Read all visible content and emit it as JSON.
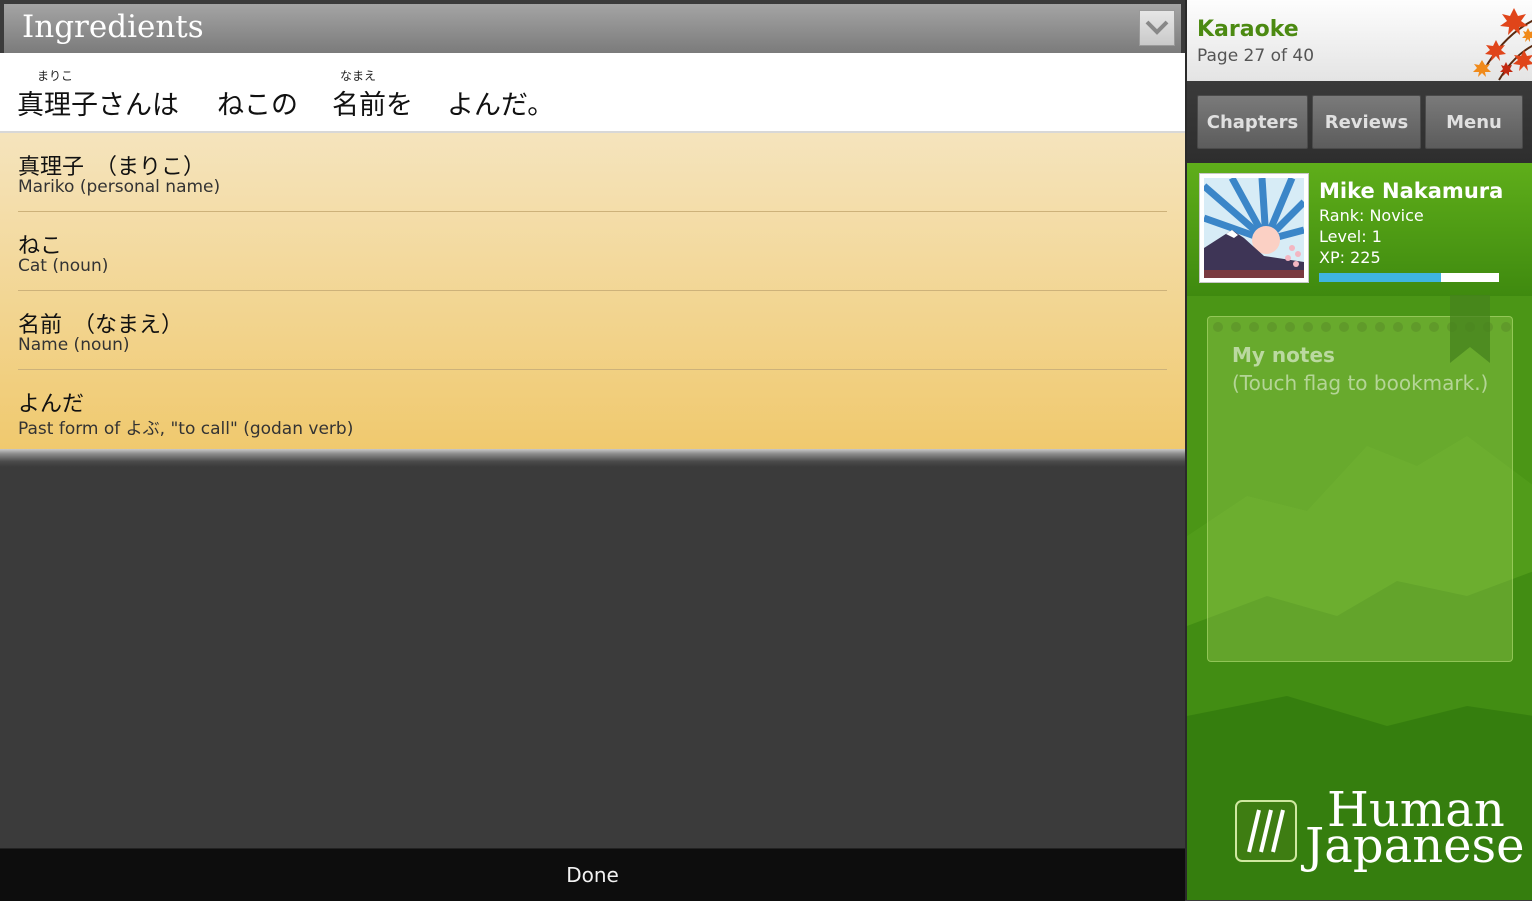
{
  "panel": {
    "title": "Ingredients",
    "collapse_icon": "chevron-down-icon"
  },
  "sentence": [
    {
      "ruby": "まりこ",
      "text": "真理子さんは"
    },
    {
      "ruby": "",
      "text": "ねこの"
    },
    {
      "ruby": "なまえ",
      "text": "名前を"
    },
    {
      "ruby": "",
      "text": "よんだ。"
    }
  ],
  "ingredients": [
    {
      "term": "真理子　（まりこ）",
      "definition": "Mariko (personal name)"
    },
    {
      "term": "ねこ",
      "definition": "Cat (noun)"
    },
    {
      "term": "名前　（なまえ）",
      "definition": "Name (noun)"
    },
    {
      "term": "よんだ",
      "definition": "Past form of よぶ, \"to call\" (godan verb)"
    }
  ],
  "footer": {
    "done_label": "Done"
  },
  "sidebar": {
    "chapter": {
      "name": "Karaoke",
      "page": "Page 27 of 40"
    },
    "nav": [
      {
        "label": "Chapters"
      },
      {
        "label": "Reviews"
      },
      {
        "label": "Menu"
      }
    ],
    "profile": {
      "name": "Mike Nakamura",
      "rank": "Rank: Novice",
      "level": "Level: 1",
      "xp": "XP: 225",
      "xp_progress_percent": 68
    },
    "notes": {
      "title": "My notes",
      "hint": "(Touch flag to bookmark.)"
    },
    "logo": {
      "line1": "Human",
      "line2": "Japanese"
    }
  },
  "colors": {
    "accent_green": "#4c8a12",
    "xp_bar": "#3fb4e0",
    "ingredient_bg_top": "#f5e4bd",
    "ingredient_bg_bottom": "#f0c96e"
  }
}
